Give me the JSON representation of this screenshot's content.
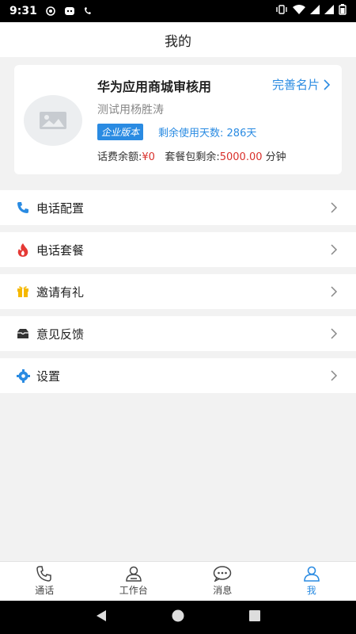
{
  "status_bar": {
    "time": "9:31"
  },
  "header": {
    "title": "我的"
  },
  "profile": {
    "name": "华为应用商城审核用",
    "complete_link": "完善名片",
    "subtitle": "测试用杨胜涛",
    "edition_badge": "企业版本",
    "days_label": "剩余使用天数:",
    "days_value": "286天",
    "balance_label": "话费余额:",
    "balance_value": "¥0",
    "package_label": "套餐包剩余:",
    "package_value": "5000.00",
    "package_unit": "分钟"
  },
  "menu": [
    {
      "label": "电话配置",
      "icon": "phone-icon",
      "color": "#2a8be2"
    },
    {
      "label": "电话套餐",
      "icon": "flame-icon",
      "color": "#e53935"
    },
    {
      "label": "邀请有礼",
      "icon": "gift-icon",
      "color": "#f5b800"
    },
    {
      "label": "意见反馈",
      "icon": "mailbox-icon",
      "color": "#333333"
    },
    {
      "label": "设置",
      "icon": "gear-icon",
      "color": "#2a8be2"
    }
  ],
  "tabs": [
    {
      "label": "通话",
      "icon": "phone-outline-icon"
    },
    {
      "label": "工作台",
      "icon": "workbench-icon"
    },
    {
      "label": "消息",
      "icon": "chat-icon"
    },
    {
      "label": "我",
      "icon": "person-icon",
      "active": true
    }
  ],
  "colors": {
    "accent": "#2a8be2",
    "money": "#d9302b",
    "background": "#f2f2f2"
  }
}
